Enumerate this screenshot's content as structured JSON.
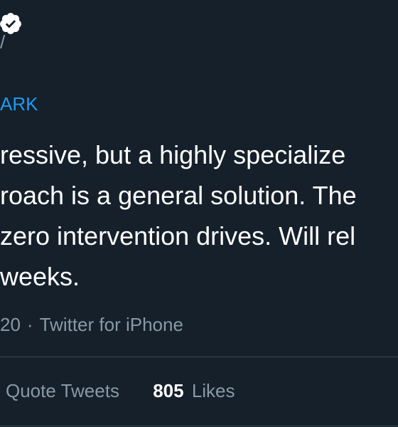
{
  "header": {
    "badge_icon": "verified-badge-icon",
    "handle_fragment": "/"
  },
  "reply": {
    "mention_fragment": "ARK"
  },
  "tweet": {
    "lines": [
      "ressive, but a highly specialize",
      "roach is a general solution. The",
      "zero intervention drives. Will rel",
      "weeks."
    ]
  },
  "meta": {
    "date_fragment": "20",
    "separator": "·",
    "source": "Twitter for iPhone"
  },
  "stats": {
    "quote_tweets_label": "Quote Tweets",
    "likes_count": "805",
    "likes_label": "Likes"
  },
  "colors": {
    "background": "#15202b",
    "text_primary": "#ffffff",
    "text_secondary": "#8899a6",
    "link": "#1d9bf0",
    "divider": "#38444d"
  }
}
